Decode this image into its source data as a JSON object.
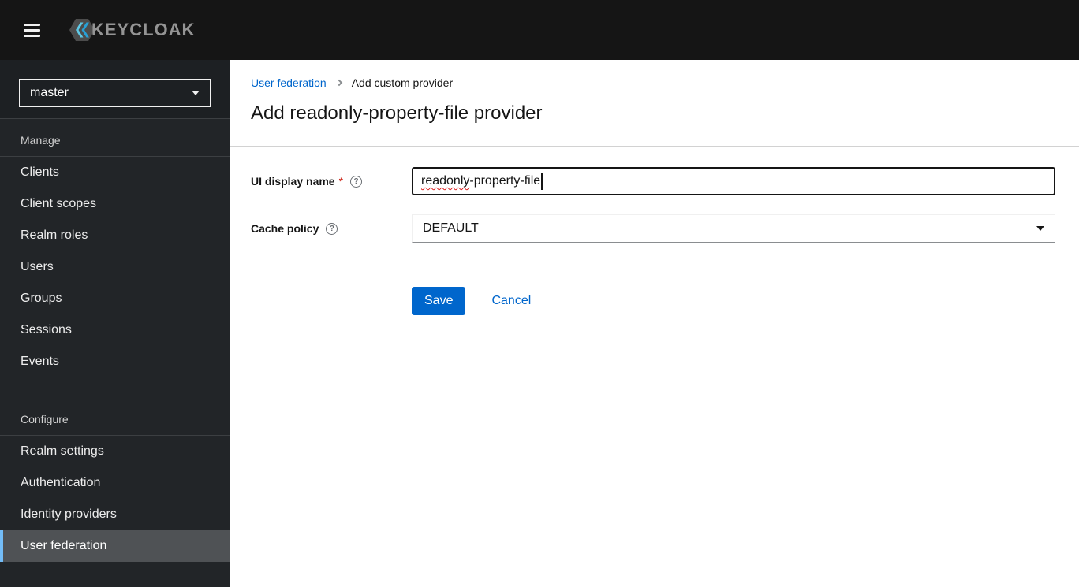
{
  "header": {
    "brand": "KEYCLOAK"
  },
  "sidebar": {
    "realm_selector": {
      "value": "master"
    },
    "sections": [
      {
        "title": "Manage",
        "items": [
          "Clients",
          "Client scopes",
          "Realm roles",
          "Users",
          "Groups",
          "Sessions",
          "Events"
        ]
      },
      {
        "title": "Configure",
        "items": [
          "Realm settings",
          "Authentication",
          "Identity providers",
          "User federation"
        ],
        "selected_item": "User federation"
      }
    ]
  },
  "breadcrumb": {
    "items": [
      {
        "label": "User federation",
        "link": true
      },
      {
        "label": "Add custom provider",
        "link": false
      }
    ]
  },
  "page": {
    "title": "Add readonly-property-file provider"
  },
  "form": {
    "required_indicator": "*",
    "fields": [
      {
        "label": "UI display name",
        "required": true,
        "type": "text",
        "value": "readonly-property-file",
        "value_parts": [
          "readonly",
          "-property-file"
        ]
      },
      {
        "label": "Cache policy",
        "required": false,
        "type": "select",
        "value": "DEFAULT"
      }
    ],
    "save_label": "Save",
    "cancel_label": "Cancel"
  },
  "icons": {
    "help_glyph": "?"
  },
  "colors": {
    "header_bg": "#151515",
    "sidebar_bg": "#212427",
    "nav_selected_bg": "#4f5255",
    "nav_selected_accent": "#73bcf7",
    "link": "#0066cc",
    "primary_button": "#0066cc",
    "required": "#c9190b"
  }
}
